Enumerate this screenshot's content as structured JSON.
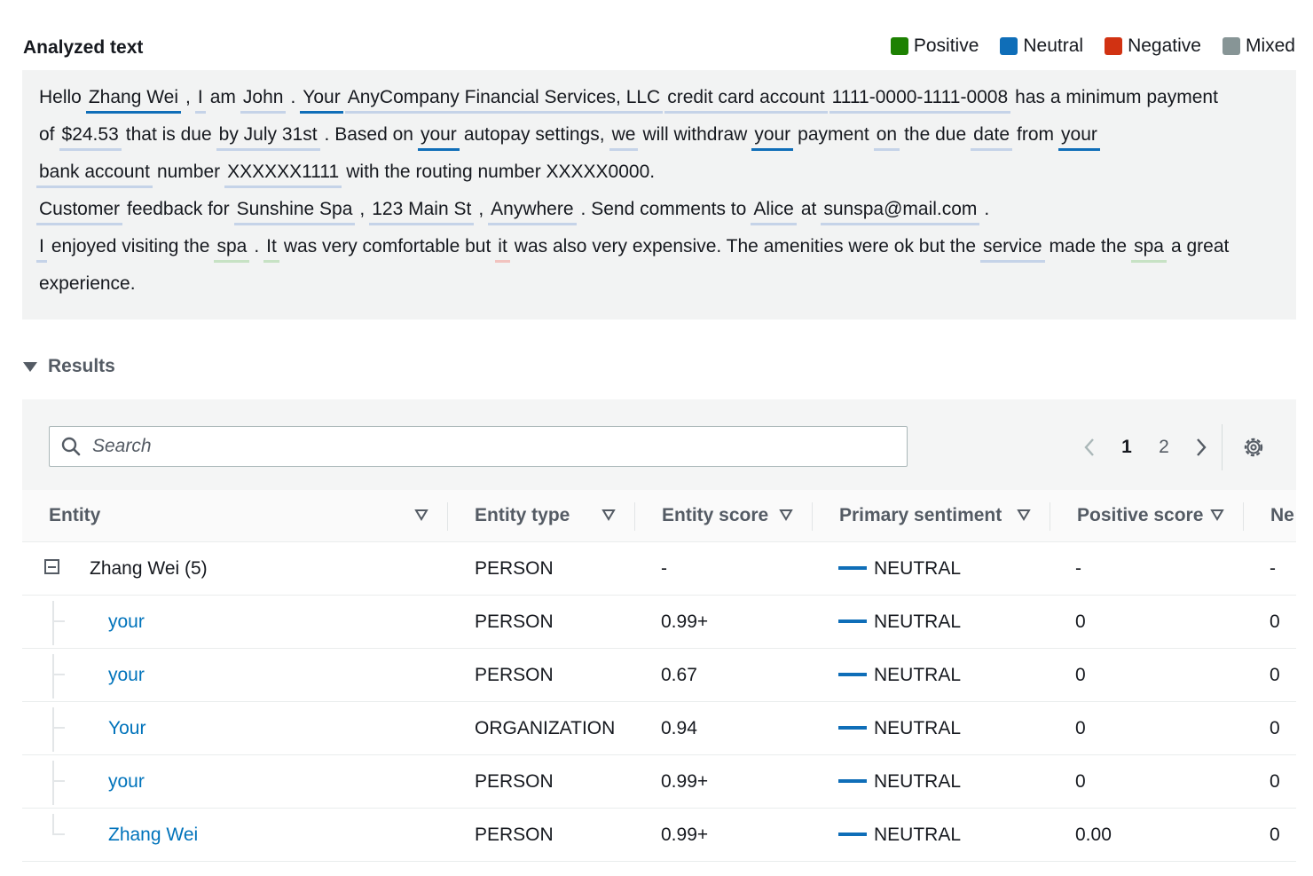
{
  "header": {
    "title": "Analyzed text"
  },
  "legend": [
    {
      "label": "Positive",
      "color": "#1d8102"
    },
    {
      "label": "Neutral",
      "color": "#0f6eb8"
    },
    {
      "label": "Negative",
      "color": "#d13212"
    },
    {
      "label": "Mixed",
      "color": "#879596"
    }
  ],
  "analyzed": {
    "lines": [
      [
        {
          "t": "Hello",
          "e": 0
        },
        {
          "t": "Zhang Wei",
          "e": 2
        },
        {
          "t": ",",
          "e": 0
        },
        {
          "t": "I",
          "e": 1
        },
        {
          "t": "am",
          "e": 0
        },
        {
          "t": "John",
          "e": 1
        },
        {
          "t": ".",
          "e": 0
        },
        {
          "t": "Your",
          "e": 2
        },
        {
          "t": "AnyCompany Financial Services, LLC",
          "e": 1
        },
        {
          "t": "credit card account",
          "e": 1
        },
        {
          "t": "1111-0000-1111-0008",
          "e": 1
        },
        {
          "t": "has a minimum payment",
          "e": 0
        }
      ],
      [
        {
          "t": "of",
          "e": 0
        },
        {
          "t": "$24.53",
          "e": 1
        },
        {
          "t": "that is due",
          "e": 0
        },
        {
          "t": "by July 31st",
          "e": 1
        },
        {
          "t": ". Based on",
          "e": 0
        },
        {
          "t": "your",
          "e": 2
        },
        {
          "t": "autopay settings,",
          "e": 0
        },
        {
          "t": "we",
          "e": 1
        },
        {
          "t": "will withdraw",
          "e": 0
        },
        {
          "t": "your",
          "e": 2
        },
        {
          "t": "payment",
          "e": 0
        },
        {
          "t": "on",
          "e": 1
        },
        {
          "t": "the due",
          "e": 0
        },
        {
          "t": "date",
          "e": 1
        },
        {
          "t": "from",
          "e": 0
        },
        {
          "t": "your",
          "e": 2
        }
      ],
      [
        {
          "t": "bank account",
          "e": 1
        },
        {
          "t": "number",
          "e": 0
        },
        {
          "t": "XXXXXX1111",
          "e": 1
        },
        {
          "t": "with the routing number XXXXX0000.",
          "e": 0
        }
      ],
      [
        {
          "t": "Customer",
          "e": 1
        },
        {
          "t": "feedback for",
          "e": 0
        },
        {
          "t": "Sunshine Spa",
          "e": 1
        },
        {
          "t": ",",
          "e": 0
        },
        {
          "t": "123 Main St",
          "e": 1
        },
        {
          "t": ",",
          "e": 0
        },
        {
          "t": "Anywhere",
          "e": 1
        },
        {
          "t": ". Send comments to",
          "e": 0
        },
        {
          "t": "Alice",
          "e": 1
        },
        {
          "t": "at",
          "e": 0
        },
        {
          "t": "sunspa@mail.com",
          "e": 1
        },
        {
          "t": ".",
          "e": 0
        }
      ],
      [
        {
          "t": "I",
          "e": 1
        },
        {
          "t": "enjoyed visiting the",
          "e": 0
        },
        {
          "t": "spa",
          "e": 3
        },
        {
          "t": ".",
          "e": 0
        },
        {
          "t": "It",
          "e": 3
        },
        {
          "t": "was very comfortable but",
          "e": 0
        },
        {
          "t": "it",
          "e": 4
        },
        {
          "t": "was also very expensive. The amenities were ok but the",
          "e": 0
        },
        {
          "t": "service",
          "e": 1
        },
        {
          "t": "made the",
          "e": 0
        },
        {
          "t": "spa",
          "e": 3
        },
        {
          "t": "a great",
          "e": 0
        }
      ],
      [
        {
          "t": "experience.",
          "e": 0
        }
      ]
    ]
  },
  "results": {
    "toggle_label": "Results",
    "search_placeholder": "Search",
    "pages": [
      "1",
      "2"
    ],
    "current_page": "1",
    "columns": [
      "Entity",
      "Entity type",
      "Entity score",
      "Primary sentiment",
      "Positive score",
      "Ne"
    ],
    "rows": [
      {
        "entity": "Zhang Wei (5)",
        "type": "PERSON",
        "score": "-",
        "sentiment": "NEUTRAL",
        "positive": "-",
        "neg": "-"
      },
      {
        "entity": "your",
        "type": "PERSON",
        "score": "0.99+",
        "sentiment": "NEUTRAL",
        "positive": "0",
        "neg": "0"
      },
      {
        "entity": "your",
        "type": "PERSON",
        "score": "0.67",
        "sentiment": "NEUTRAL",
        "positive": "0",
        "neg": "0"
      },
      {
        "entity": "Your",
        "type": "ORGANIZATION",
        "score": "0.94",
        "sentiment": "NEUTRAL",
        "positive": "0",
        "neg": "0"
      },
      {
        "entity": "your",
        "type": "PERSON",
        "score": "0.99+",
        "sentiment": "NEUTRAL",
        "positive": "0",
        "neg": "0"
      },
      {
        "entity": "Zhang Wei",
        "type": "PERSON",
        "score": "0.99+",
        "sentiment": "NEUTRAL",
        "positive": "0.00",
        "neg": "0"
      }
    ]
  }
}
